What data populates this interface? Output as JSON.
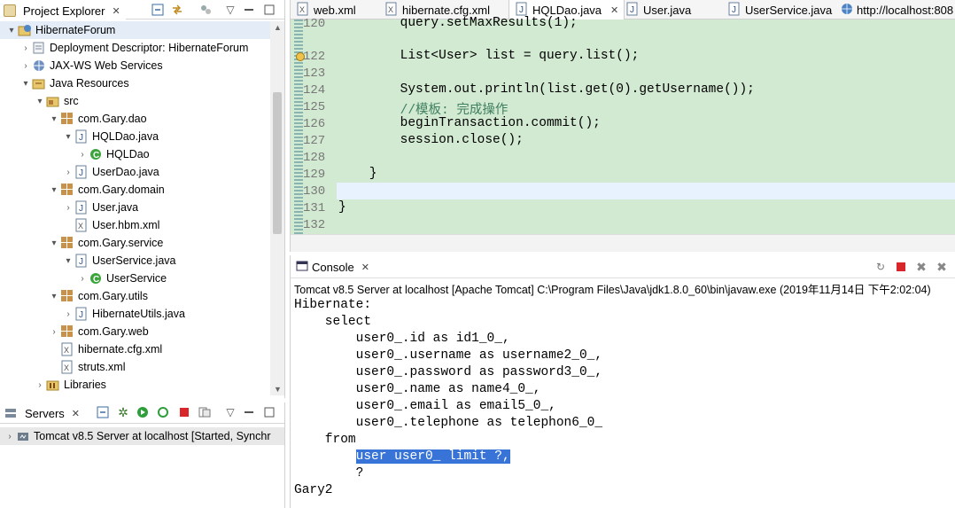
{
  "explorer": {
    "title": "Project Explorer",
    "close": "✕"
  },
  "tree": [
    {
      "label": "HibernateForum",
      "depth": 0,
      "arrow": "▾",
      "icon": "web-project-icon",
      "selected": true
    },
    {
      "label": "Deployment Descriptor: HibernateForum",
      "depth": 1,
      "arrow": "›",
      "icon": "descriptor-icon"
    },
    {
      "label": "JAX-WS Web Services",
      "depth": 1,
      "arrow": "›",
      "icon": "webservices-icon"
    },
    {
      "label": "Java Resources",
      "depth": 1,
      "arrow": "▾",
      "icon": "java-resources-icon"
    },
    {
      "label": "src",
      "depth": 2,
      "arrow": "▾",
      "icon": "source-folder-icon"
    },
    {
      "label": "com.Gary.dao",
      "depth": 3,
      "arrow": "▾",
      "icon": "package-icon"
    },
    {
      "label": "HQLDao.java",
      "depth": 4,
      "arrow": "▾",
      "icon": "java-file-icon"
    },
    {
      "label": "HQLDao",
      "depth": 5,
      "arrow": "›",
      "icon": "class-icon"
    },
    {
      "label": "UserDao.java",
      "depth": 4,
      "arrow": "›",
      "icon": "java-file-icon"
    },
    {
      "label": "com.Gary.domain",
      "depth": 3,
      "arrow": "▾",
      "icon": "package-icon"
    },
    {
      "label": "User.java",
      "depth": 4,
      "arrow": "›",
      "icon": "java-file-icon"
    },
    {
      "label": "User.hbm.xml",
      "depth": 4,
      "arrow": "",
      "icon": "xml-file-icon"
    },
    {
      "label": "com.Gary.service",
      "depth": 3,
      "arrow": "▾",
      "icon": "package-icon"
    },
    {
      "label": "UserService.java",
      "depth": 4,
      "arrow": "▾",
      "icon": "java-file-icon"
    },
    {
      "label": "UserService",
      "depth": 5,
      "arrow": "›",
      "icon": "class-icon"
    },
    {
      "label": "com.Gary.utils",
      "depth": 3,
      "arrow": "▾",
      "icon": "package-icon"
    },
    {
      "label": "HibernateUtils.java",
      "depth": 4,
      "arrow": "›",
      "icon": "java-file-icon"
    },
    {
      "label": "com.Gary.web",
      "depth": 3,
      "arrow": "›",
      "icon": "package-icon"
    },
    {
      "label": "hibernate.cfg.xml",
      "depth": 3,
      "arrow": "",
      "icon": "xml-file-icon"
    },
    {
      "label": "struts.xml",
      "depth": 3,
      "arrow": "",
      "icon": "xml-file-icon"
    },
    {
      "label": "Libraries",
      "depth": 2,
      "arrow": "›",
      "icon": "libraries-icon"
    }
  ],
  "servers": {
    "title": "Servers",
    "close": "✕",
    "item": "Tomcat v8.5 Server at localhost  [Started, Synchr"
  },
  "editor_tabs": [
    {
      "label": "web.xml",
      "icon": "xml-file-icon",
      "close": ""
    },
    {
      "label": "hibernate.cfg.xml",
      "icon": "xml-file-icon",
      "close": ""
    },
    {
      "label": "HQLDao.java",
      "icon": "java-file-icon",
      "close": "✕",
      "active": true
    },
    {
      "label": "User.java",
      "icon": "java-file-icon",
      "close": ""
    },
    {
      "label": "UserService.java",
      "icon": "java-file-icon",
      "close": ""
    },
    {
      "label": "http://localhost:808",
      "icon": "globe-icon",
      "close": ""
    }
  ],
  "code_lines": [
    {
      "num": "120",
      "text": "        query.setMaxResults(1);"
    },
    {
      "num": "122",
      "text": "        List<User> list = query.list();"
    },
    {
      "num": "123",
      "text": ""
    },
    {
      "num": "124",
      "text": "        System.out.println(list.get(0).getUsername());"
    },
    {
      "num": "125",
      "text": "        //模板: 完成操作"
    },
    {
      "num": "126",
      "text": "        beginTransaction.commit();"
    },
    {
      "num": "127",
      "text": "        session.close();"
    },
    {
      "num": "128",
      "text": ""
    },
    {
      "num": "129",
      "text": "    }"
    },
    {
      "num": "130",
      "text": ""
    },
    {
      "num": "131",
      "text": "}"
    },
    {
      "num": "132",
      "text": ""
    }
  ],
  "console": {
    "title": "Console",
    "close": "✕",
    "status": "Tomcat v8.5 Server at localhost [Apache Tomcat] C:\\Program Files\\Java\\jdk1.8.0_60\\bin\\javaw.exe (2019年11月14日 下午2:02:04)",
    "lines": [
      "Hibernate:",
      "    select",
      "        user0_.id as id1_0_,",
      "        user0_.username as username2_0_,",
      "        user0_.password as password3_0_,",
      "        user0_.name as name4_0_,",
      "        user0_.email as email5_0_,",
      "        user0_.telephone as telephon6_0_",
      "    from",
      "        user user0_ limit ?,",
      "        ?",
      "Gary2"
    ],
    "highlight_line": 9
  }
}
